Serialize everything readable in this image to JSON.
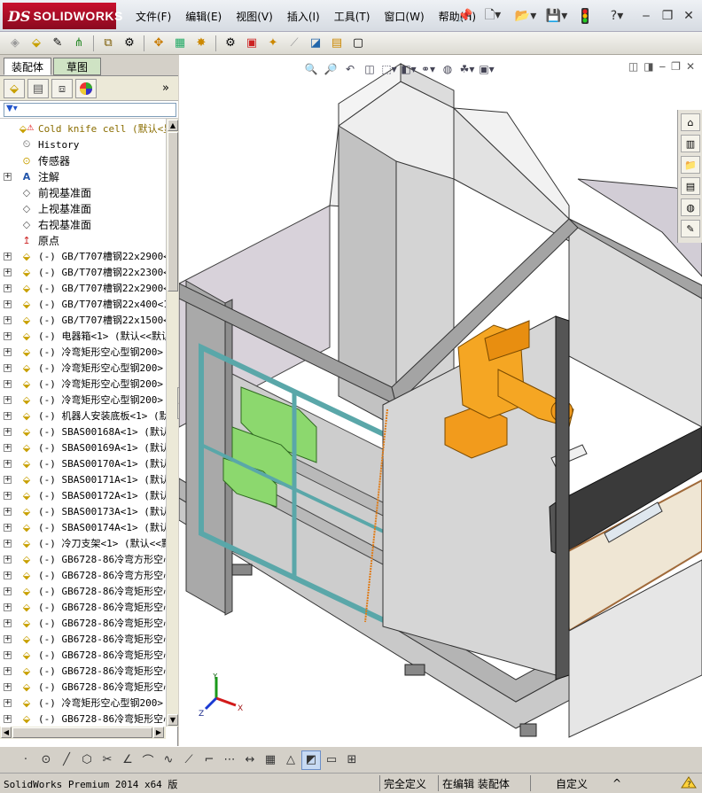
{
  "app": {
    "brand_mark": "DS",
    "brand_name": "SOLIDWORKS"
  },
  "menu": [
    "文件(F)",
    "编辑(E)",
    "视图(V)",
    "插入(I)",
    "工具(T)",
    "窗口(W)",
    "帮助(H)"
  ],
  "title_icons": [
    "pin-icon",
    "new-doc-icon",
    "open-icon",
    "save-icon",
    "traffic-light-icon",
    "help-icon",
    "minimize-icon",
    "restore-icon",
    "close-icon"
  ],
  "left_panel": {
    "tabs": [
      "装配体",
      "草图"
    ],
    "active_tab": "装配体",
    "panel_icons": [
      "feature-manager-icon",
      "property-manager-icon",
      "configuration-manager-icon",
      "display-manager-icon"
    ],
    "more": "»",
    "tree": [
      {
        "label": "Cold knife cell  (默认<显",
        "icon": "assembly-warning-icon",
        "expander": "",
        "color": "#8a6d00"
      },
      {
        "label": "History",
        "icon": "history-icon",
        "expander": ""
      },
      {
        "label": "传感器",
        "icon": "sensor-icon",
        "expander": "",
        "cjk": true
      },
      {
        "label": "注解",
        "icon": "annotation-icon",
        "expander": "+",
        "cjk": true
      },
      {
        "label": "前视基准面",
        "icon": "plane-icon",
        "expander": "",
        "cjk": true
      },
      {
        "label": "上视基准面",
        "icon": "plane-icon",
        "expander": "",
        "cjk": true
      },
      {
        "label": "右视基准面",
        "icon": "plane-icon",
        "expander": "",
        "cjk": true
      },
      {
        "label": "原点",
        "icon": "origin-icon",
        "expander": "",
        "cjk": true
      },
      {
        "label": "(-) GB/T707槽钢22x2900<",
        "icon": "part-icon",
        "expander": "+"
      },
      {
        "label": "(-) GB/T707槽钢22x2300<",
        "icon": "part-icon",
        "expander": "+"
      },
      {
        "label": "(-) GB/T707槽钢22x2900<",
        "icon": "part-icon",
        "expander": "+"
      },
      {
        "label": "(-) GB/T707槽钢22x400<1",
        "icon": "part-icon",
        "expander": "+"
      },
      {
        "label": "(-) GB/T707槽钢22x1500<",
        "icon": "part-icon",
        "expander": "+"
      },
      {
        "label": "(-) 电器箱<1> (默认<<默认",
        "icon": "part-icon",
        "expander": "+"
      },
      {
        "label": "(-) 冷弯矩形空心型钢200>",
        "icon": "part-icon",
        "expander": "+"
      },
      {
        "label": "(-) 冷弯矩形空心型钢200>",
        "icon": "part-icon",
        "expander": "+"
      },
      {
        "label": "(-) 冷弯矩形空心型钢200>",
        "icon": "part-icon",
        "expander": "+"
      },
      {
        "label": "(-) 冷弯矩形空心型钢200>",
        "icon": "part-icon",
        "expander": "+"
      },
      {
        "label": "(-) 机器人安装底板<1> (默",
        "icon": "part-icon",
        "expander": "+"
      },
      {
        "label": "(-) SBAS00168A<1> (默认<",
        "icon": "part-icon",
        "expander": "+"
      },
      {
        "label": "(-) SBAS00169A<1> (默认<",
        "icon": "part-icon",
        "expander": "+"
      },
      {
        "label": "(-) SBAS00170A<1> (默认<",
        "icon": "part-icon",
        "expander": "+"
      },
      {
        "label": "(-) SBAS00171A<1> (默认<",
        "icon": "part-icon",
        "expander": "+"
      },
      {
        "label": "(-) SBAS00172A<1> (默认<",
        "icon": "part-icon",
        "expander": "+"
      },
      {
        "label": "(-) SBAS00173A<1> (默认<",
        "icon": "part-icon",
        "expander": "+"
      },
      {
        "label": "(-) SBAS00174A<1> (默认<",
        "icon": "part-icon",
        "expander": "+"
      },
      {
        "label": "(-) 冷刀支架<1> (默认<<默",
        "icon": "part-icon",
        "expander": "+"
      },
      {
        "label": "(-) GB6728-86冷弯方形空心",
        "icon": "part-icon",
        "expander": "+"
      },
      {
        "label": "(-) GB6728-86冷弯方形空心",
        "icon": "part-icon",
        "expander": "+"
      },
      {
        "label": "(-) GB6728-86冷弯矩形空心",
        "icon": "part-icon",
        "expander": "+"
      },
      {
        "label": "(-) GB6728-86冷弯矩形空心",
        "icon": "part-icon",
        "expander": "+"
      },
      {
        "label": "(-) GB6728-86冷弯矩形空心",
        "icon": "part-icon",
        "expander": "+"
      },
      {
        "label": "(-) GB6728-86冷弯矩形空心",
        "icon": "part-icon",
        "expander": "+"
      },
      {
        "label": "(-) GB6728-86冷弯矩形空心",
        "icon": "part-icon",
        "expander": "+"
      },
      {
        "label": "(-) GB6728-86冷弯矩形空心",
        "icon": "part-icon",
        "expander": "+"
      },
      {
        "label": "(-) GB6728-86冷弯矩形空心",
        "icon": "part-icon",
        "expander": "+"
      },
      {
        "label": "(-) 冷弯矩形空心型钢200>",
        "icon": "part-icon",
        "expander": "+"
      },
      {
        "label": "(-) GB6728-86冷弯矩形空心",
        "icon": "part-icon",
        "expander": "+"
      },
      {
        "label": "(-) GB6728-86冷弯矩形空心",
        "icon": "part-icon",
        "expander": "+"
      }
    ]
  },
  "triad": {
    "x": "X",
    "y": "Y",
    "z": "Z"
  },
  "status": {
    "product": "SolidWorks Premium 2014 x64 版",
    "definition": "完全定义",
    "editing": "在编辑 装配体",
    "custom": "自定义",
    "help_icon": "?"
  }
}
